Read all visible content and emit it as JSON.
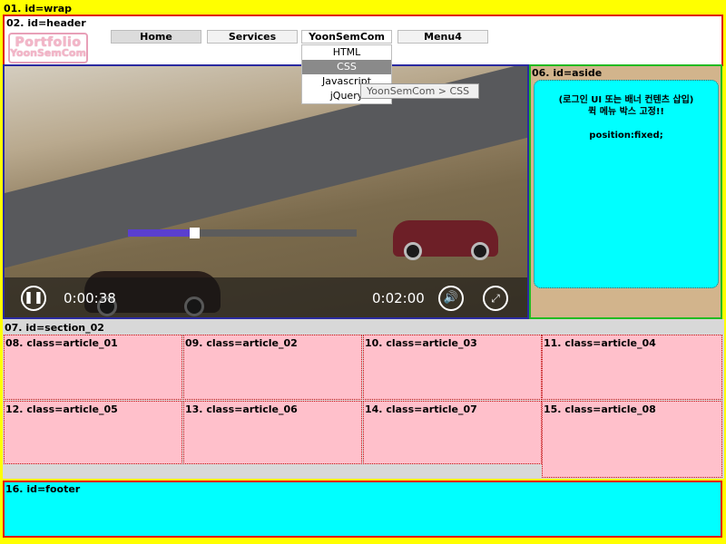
{
  "wrap_label": "01. id=wrap",
  "header": {
    "label": "02. id=header",
    "logo": {
      "line1": "Portfolio",
      "line2": "YoonSemCom"
    },
    "menu": [
      "Home",
      "Services",
      "YoonSemCom",
      "Menu4"
    ],
    "submenu": [
      "HTML",
      "CSS",
      "Javascript",
      "jQuery"
    ],
    "tooltip": "YoonSemCom > CSS"
  },
  "video": {
    "current_time": "0:00:38",
    "total_time": "0:02:00",
    "progress_fraction": 0.27
  },
  "aside": {
    "label": "06. id=aside",
    "line1": "(로그인 UI 또는 배너 컨텐츠 삽입)",
    "line2": "퀵 메뉴 박스 고정!!",
    "line3": "position:fixed;"
  },
  "section02": {
    "label": "07. id=section_02",
    "articles": [
      "08. class=article_01",
      "09. class=article_02",
      "10. class=article_03",
      "11. class=article_04",
      "12. class=article_05",
      "13. class=article_06",
      "14. class=article_07",
      "15. class=article_08"
    ]
  },
  "footer_label": "16. id=footer",
  "colors": {
    "wrap": "#ffff00",
    "header_border": "#e01010",
    "aside": "#d2b48c",
    "aside_box": "#00ffff",
    "article": "#ffc0cb",
    "footer": "#00ffff",
    "progress": "#5a3fcf"
  }
}
